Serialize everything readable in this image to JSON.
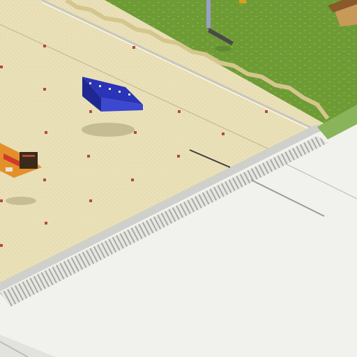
{
  "scene": {
    "type": "isometric-voxel-game-view",
    "palette": {
      "sand": "#e9e0b8",
      "sand_dark": "#d8cc9c",
      "grass": "#6e9b35",
      "grass_light": "#7fae3e",
      "roof": "#f1f1ee",
      "roof_shadow": "#cfcfcb",
      "stripe": "#a9a9a4",
      "ship_blue": "#2a34b8",
      "sign_orange": "#e4902a",
      "lamp_red": "#b44a3a"
    },
    "objects": [
      {
        "name": "grass-field",
        "kind": "terrain"
      },
      {
        "name": "sand-plaza",
        "kind": "terrain"
      },
      {
        "name": "white-roof-building",
        "kind": "structure"
      },
      {
        "name": "blue-floating-structure",
        "kind": "entity"
      },
      {
        "name": "orange-vendor-stall",
        "kind": "structure"
      },
      {
        "name": "hut",
        "kind": "structure"
      },
      {
        "name": "crane-arm",
        "kind": "entity"
      }
    ]
  }
}
